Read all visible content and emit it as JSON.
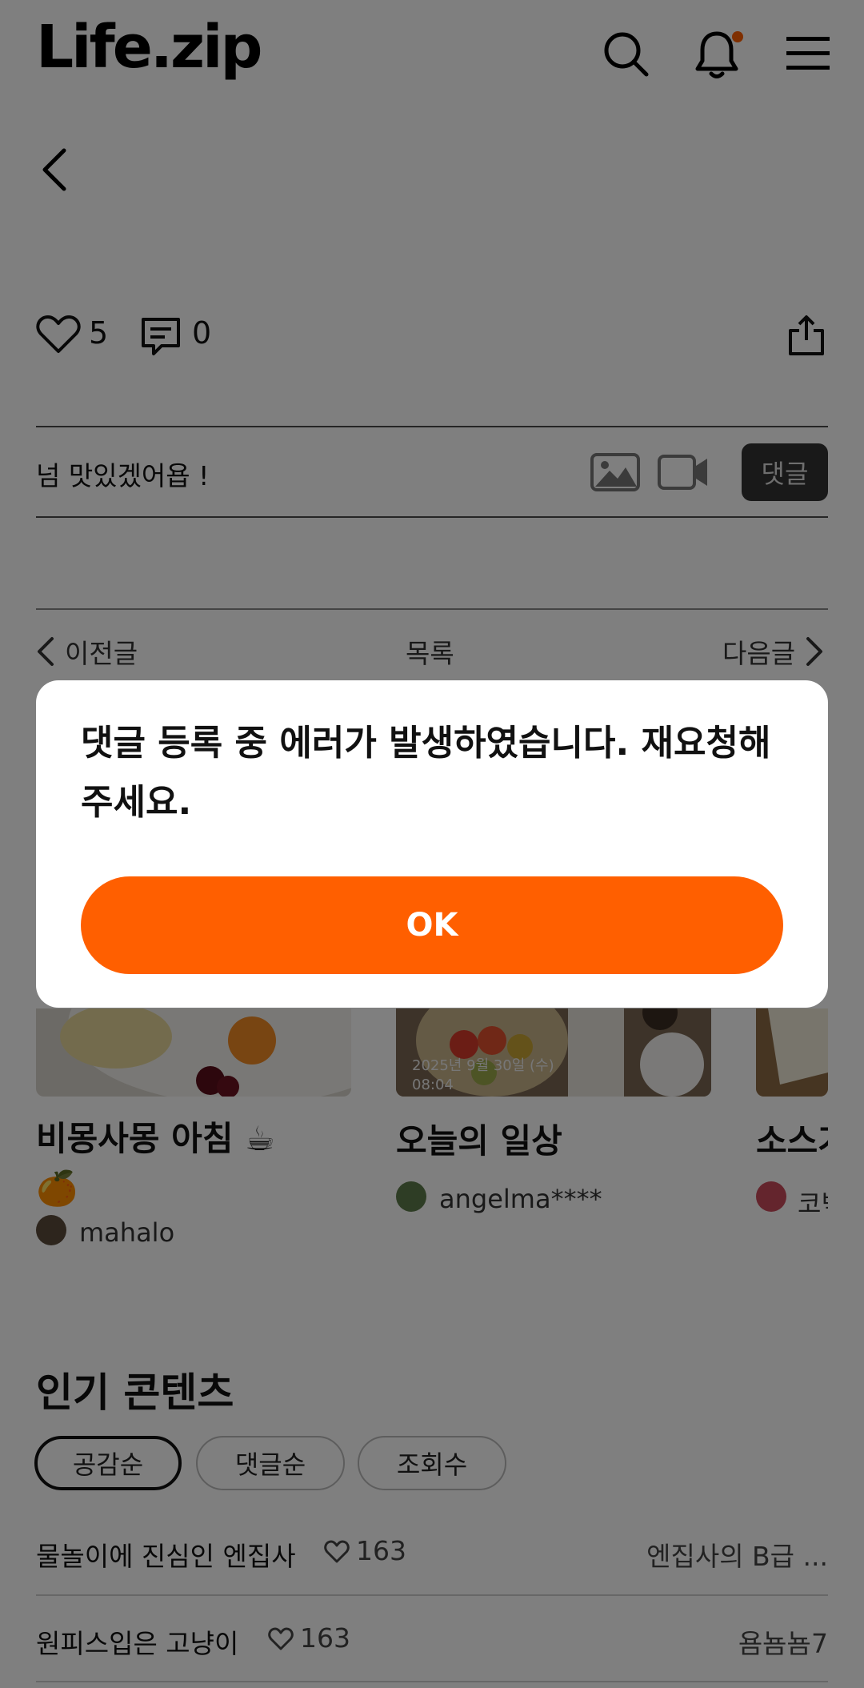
{
  "header": {
    "logo": "Life.zip",
    "icons": [
      "search-icon",
      "bell-icon",
      "menu-icon"
    ],
    "notification_dot_color": "#ff5f00"
  },
  "post": {
    "likes": "5",
    "comments": "0"
  },
  "comment_input": {
    "value": "넘 맛있겠어욥 !",
    "submit_label": "댓글"
  },
  "post_nav": {
    "prev": "이전글",
    "list": "목록",
    "next": "다음글"
  },
  "cards": [
    {
      "title": "비몽사몽 아침 ☕ 🍊",
      "author": "mahalo"
    },
    {
      "title": "오늘의 일상",
      "author": "angelma****",
      "photo_stamp_date": "2025년 9월 30일 (수)",
      "photo_stamp_time": "08:04"
    },
    {
      "title": "소스가",
      "author": "코빅"
    }
  ],
  "popular": {
    "title": "인기 콘텐츠",
    "chips": [
      "공감순",
      "댓글순",
      "조회수"
    ],
    "active_chip": "공감순",
    "items": [
      {
        "title": "물놀이에 진심인 엔집사",
        "likes": "163",
        "author": "엔집사의 B급 ..."
      },
      {
        "title": "원피스입은 고냥이",
        "likes": "163",
        "author": "욤뇸뇸7"
      }
    ]
  },
  "dialog": {
    "message": "댓글 등록 중 에러가 발생하였습니다. 재요청해주세요.",
    "ok_label": "OK",
    "ok_color": "#ff5f00"
  }
}
